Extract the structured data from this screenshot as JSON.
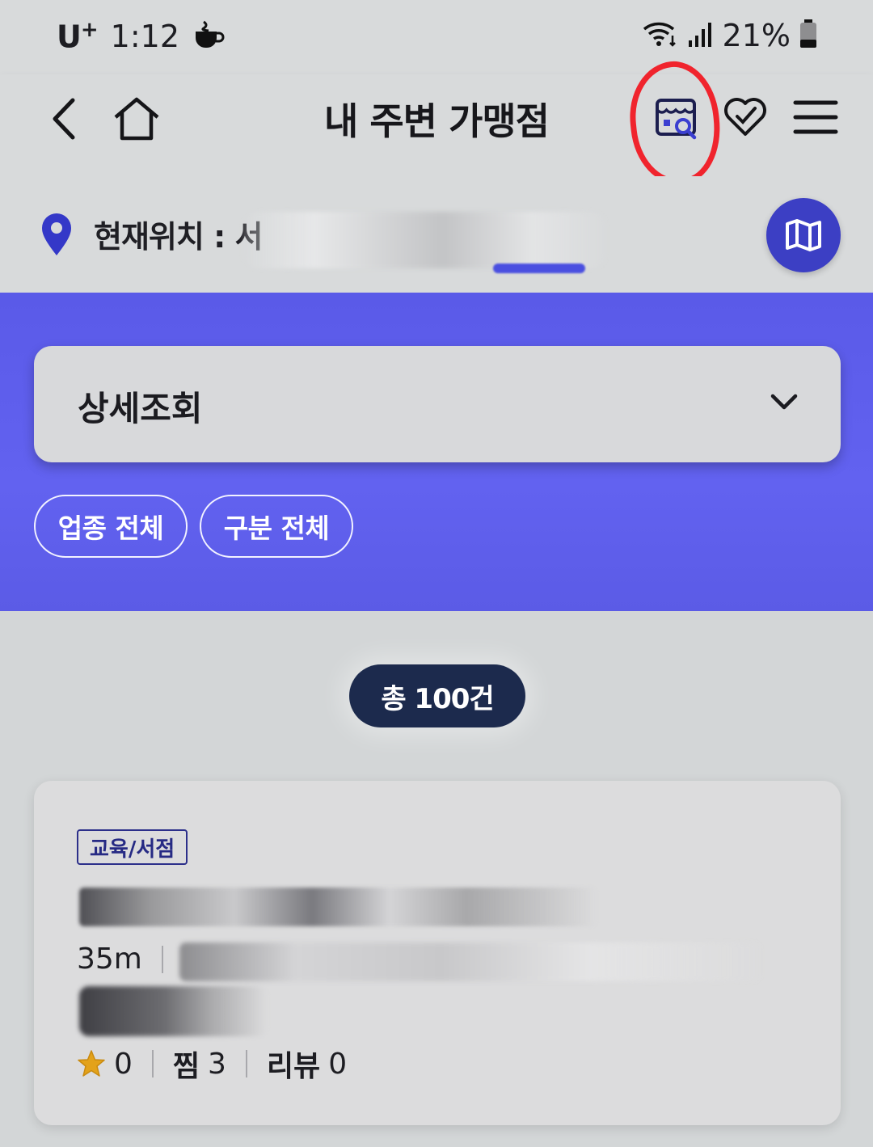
{
  "status_bar": {
    "carrier": "U",
    "carrier_sup": "+",
    "time": "1:12",
    "battery": "21%"
  },
  "header": {
    "title": "내 주변 가맹점"
  },
  "location": {
    "label": "현재위치 : 서"
  },
  "filters": {
    "detail_select": "상세조회",
    "chip_category": "업종 전체",
    "chip_type": "구분 전체"
  },
  "results": {
    "total": "총 100건"
  },
  "store": {
    "category": "교육/서점",
    "distance": "35m",
    "rating": "0",
    "favorites_label": "찜",
    "favorites": "3",
    "reviews_label": "리뷰",
    "reviews": "0"
  },
  "colors": {
    "accent_purple": "#5f5fee",
    "map_button": "#3c3fc4",
    "badge_navy": "#1c2a4d",
    "annotation_red": "#f0242d",
    "star": "#e3a21a"
  },
  "icons": [
    "back-icon",
    "home-icon",
    "store-search-icon",
    "heart-check-icon",
    "menu-icon",
    "location-pin-icon",
    "map-icon",
    "chevron-down-icon",
    "star-icon",
    "wifi-icon",
    "signal-icon",
    "battery-icon",
    "coffee-icon"
  ]
}
